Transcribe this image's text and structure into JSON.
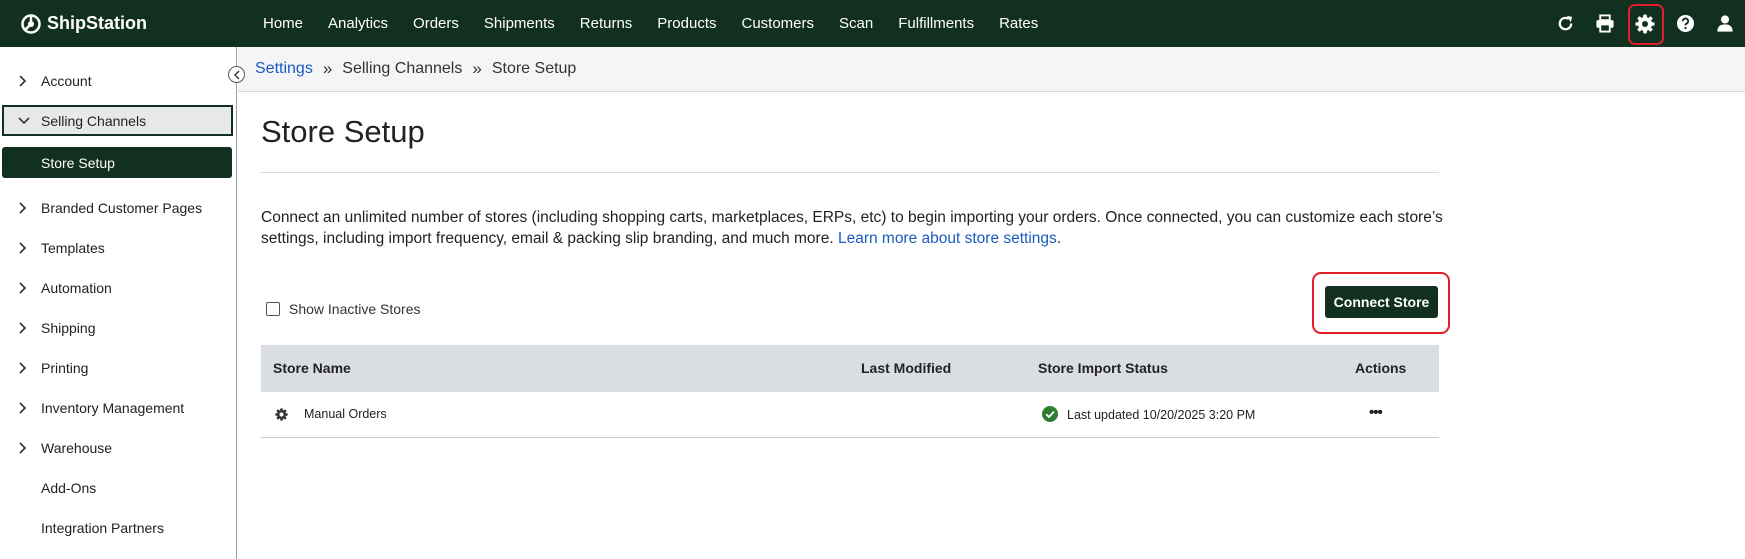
{
  "app": {
    "name": "ShipStation"
  },
  "nav": [
    {
      "label": "Home"
    },
    {
      "label": "Analytics"
    },
    {
      "label": "Orders"
    },
    {
      "label": "Shipments"
    },
    {
      "label": "Returns"
    },
    {
      "label": "Products"
    },
    {
      "label": "Customers"
    },
    {
      "label": "Scan"
    },
    {
      "label": "Fulfillments"
    },
    {
      "label": "Rates"
    }
  ],
  "tools": [
    "refresh-icon",
    "printer-icon",
    "gear-icon",
    "help-icon",
    "user-icon"
  ],
  "sidebar": {
    "items": [
      {
        "label": "Account"
      },
      {
        "label": "Selling Channels"
      },
      {
        "label": "Store Setup"
      },
      {
        "label": "Branded Customer Pages"
      },
      {
        "label": "Templates"
      },
      {
        "label": "Automation"
      },
      {
        "label": "Shipping"
      },
      {
        "label": "Printing"
      },
      {
        "label": "Inventory Management"
      },
      {
        "label": "Warehouse"
      },
      {
        "label": "Add-Ons"
      },
      {
        "label": "Integration Partners"
      }
    ]
  },
  "breadcrumb": {
    "root": "Settings",
    "middle": "Selling Channels",
    "current": "Store Setup"
  },
  "page": {
    "title": "Store Setup",
    "description": "Connect an unlimited number of stores (including shopping carts, marketplaces, ERPs, etc) to begin importing your orders. Once connected, you can customize each store’s settings, including import frequency, email & packing slip branding, and much more. ",
    "learn_more": "Learn more about store settings",
    "period": ".",
    "show_inactive": "Show Inactive Stores",
    "connect_store": "Connect Store"
  },
  "table": {
    "headers": {
      "name": "Store Name",
      "modified": "Last Modified",
      "status": "Store Import Status",
      "actions": "Actions"
    },
    "rows": [
      {
        "name": "Manual Orders",
        "modified": "",
        "status": "Last updated 10/20/2025 3:20 PM",
        "actions": "•••"
      }
    ]
  },
  "colors": {
    "brand": "#12301f",
    "link": "#1a5bbf",
    "highlight": "#e21d2a",
    "success": "#2e7d32"
  }
}
